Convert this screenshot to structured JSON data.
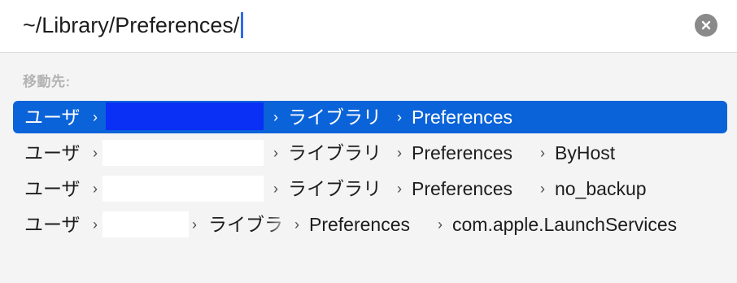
{
  "input": {
    "value": "~/Library/Preferences/"
  },
  "section_label": "移動先:",
  "colors": {
    "selection": "#0a63d8",
    "redaction_selected": "#0a2ff5",
    "caret": "#2f6de8"
  },
  "icons": {
    "clear": "x-circle-icon",
    "separator": "chevron-right-icon"
  },
  "rows": [
    {
      "user": "ユーザ",
      "library": "ライブラリ",
      "prefs": "Preferences",
      "extra": "",
      "selected": true
    },
    {
      "user": "ユーザ",
      "library": "ライブラリ",
      "prefs": "Preferences",
      "extra": "ByHost",
      "selected": false
    },
    {
      "user": "ユーザ",
      "library": "ライブラリ",
      "prefs": "Preferences",
      "extra": "no_backup",
      "selected": false
    },
    {
      "user": "ユーザ",
      "library": "ライブラ",
      "prefs": "Preferences",
      "extra": "com.apple.LaunchServices",
      "selected": false
    }
  ]
}
